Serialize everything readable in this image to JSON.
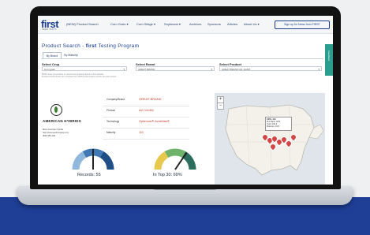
{
  "nav": {
    "logo": "first",
    "logo_sub": "SEED TESTS",
    "links": [
      "(NEW) Product Search",
      "Corn Grain ▾",
      "Corn Silage ▾",
      "Soybeans ▾",
      "Archives",
      "Sponsors",
      "Articles",
      "About Us ▾"
    ],
    "signup": "Sign up for News from FIRST"
  },
  "side_tab": "Feedback",
  "page": {
    "title_prefix": "Product Search - ",
    "title_brand": "first",
    "title_suffix": " Testing Program",
    "tabs": [
      "By Brand",
      "By Maturity"
    ]
  },
  "filters": {
    "crop_label": "Select Crop",
    "crop_value": "Corn grain",
    "brand_label": "Select Brand",
    "brand_value": "GREAT BRAND",
    "product_label": "Select Product",
    "product_value": "GREAT BRAND AG 1114M",
    "note": "FIRST does not endorse or recommend products listed on this website.",
    "note2": "Product results shown are compiled from FIRST trial locations across all years tested."
  },
  "brand": {
    "name": "AMERICAN HYBRIDS",
    "contact": [
      "Brian American Hybrids",
      "http://www.seedcompany.com",
      "(800) 555-1111"
    ]
  },
  "details": [
    {
      "key": "Company/Brand",
      "value": "GREAT BRAND"
    },
    {
      "key": "Product",
      "value": "AG 1114M"
    },
    {
      "key": "Technology",
      "value": "Optimum® AcreMax®"
    },
    {
      "key": "Maturity",
      "value": "111"
    }
  ],
  "gauges": [
    {
      "label": "Records: 55",
      "level": 0.5,
      "colors": [
        "#8fb8dc",
        "#3f78b5",
        "#1f4f86"
      ]
    },
    {
      "label": "In Top 30: 69%",
      "level": 0.69,
      "colors": [
        "#e6c84a",
        "#6fb36b",
        "#2b6e5e"
      ]
    }
  ],
  "map": {
    "zoom_in": "+",
    "zoom_out": "−",
    "popup": [
      "Cliffs, OH",
      "Plot Rank: 9/22",
      "Yield: 240.3",
      "Moisture: 19.8"
    ]
  },
  "colors": {
    "brand_blue": "#1d3f8f",
    "accent_red": "#c0392b",
    "tab_teal": "#2a9d8f"
  }
}
